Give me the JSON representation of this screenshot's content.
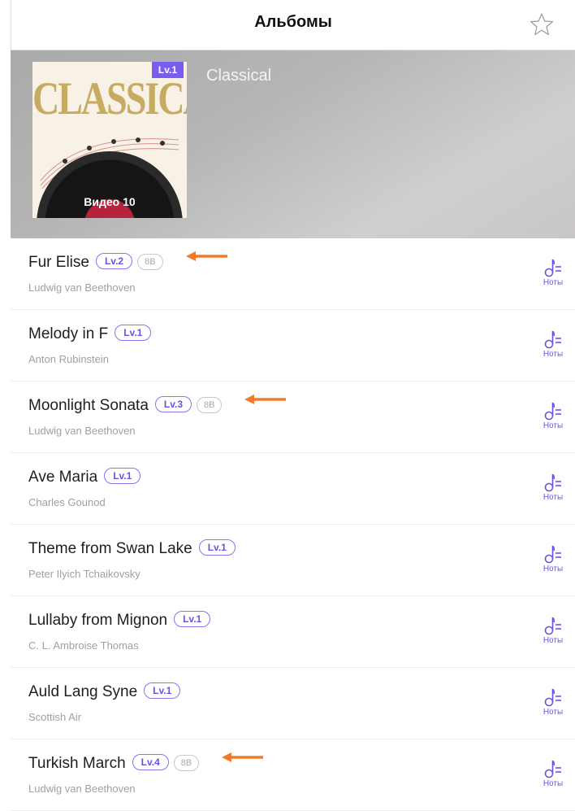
{
  "header": {
    "title": "Альбомы",
    "star_icon": "star-outline-icon"
  },
  "album": {
    "title": "Classical",
    "cover_text": "CLASSICAL",
    "level": "Lv.1",
    "video_label": "Видео 10"
  },
  "songs": [
    {
      "title": "Fur Elise",
      "artist": "Ludwig van Beethoven",
      "level": "Lv.2",
      "tag": "8B",
      "arrow": true
    },
    {
      "title": "Melody in F",
      "artist": "Anton Rubinstein",
      "level": "Lv.1",
      "tag": "",
      "arrow": false
    },
    {
      "title": "Moonlight Sonata",
      "artist": "Ludwig van Beethoven",
      "level": "Lv.3",
      "tag": "8B",
      "arrow": true
    },
    {
      "title": "Ave Maria",
      "artist": "Charles Gounod",
      "level": "Lv.1",
      "tag": "",
      "arrow": false
    },
    {
      "title": "Theme from Swan Lake",
      "artist": "Peter Ilyich Tchaikovsky",
      "level": "Lv.1",
      "tag": "",
      "arrow": false
    },
    {
      "title": "Lullaby from Mignon",
      "artist": "C. L. Ambroise Thomas",
      "level": "Lv.1",
      "tag": "",
      "arrow": false
    },
    {
      "title": "Auld Lang Syne",
      "artist": "Scottish Air",
      "level": "Lv.1",
      "tag": "",
      "arrow": false
    },
    {
      "title": "Turkish March",
      "artist": "Ludwig van Beethoven",
      "level": "Lv.4",
      "tag": "8B",
      "arrow": true
    }
  ],
  "notes_label": "Ноты",
  "colors": {
    "accent": "#6b52e6",
    "arrow": "#f07a2a",
    "badge_fill": "#7b5cf0"
  }
}
